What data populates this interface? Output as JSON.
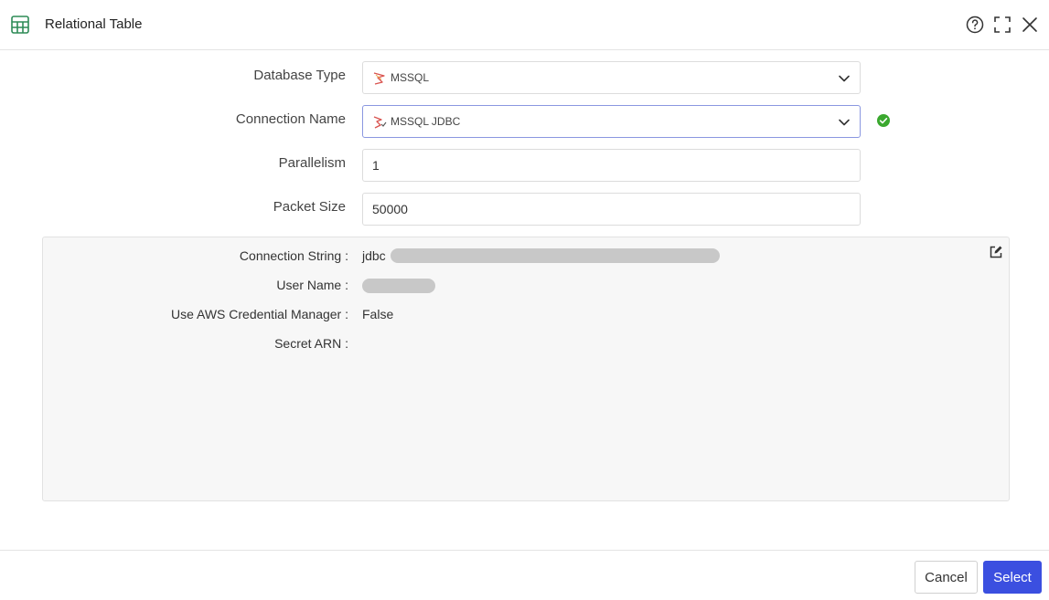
{
  "header": {
    "title": "Relational Table"
  },
  "form": {
    "database_type": {
      "label": "Database Type",
      "value": "MSSQL"
    },
    "connection_name": {
      "label": "Connection Name",
      "value": "MSSQL JDBC"
    },
    "parallelism": {
      "label": "Parallelism",
      "value": "1"
    },
    "packet_size": {
      "label": "Packet Size",
      "value": "50000"
    }
  },
  "connection_info": {
    "connection_string": {
      "label": "Connection String :",
      "value": "jdbc"
    },
    "user_name": {
      "label": "User Name :",
      "value": ""
    },
    "aws_credential": {
      "label": "Use AWS Credential Manager :",
      "value": "False"
    },
    "secret_arn": {
      "label": "Secret ARN :",
      "value": ""
    }
  },
  "footer": {
    "cancel_label": "Cancel",
    "select_label": "Select"
  },
  "colors": {
    "accent": "#3b4fe0",
    "success": "#3aa82e",
    "app_icon": "#2e8b57"
  }
}
